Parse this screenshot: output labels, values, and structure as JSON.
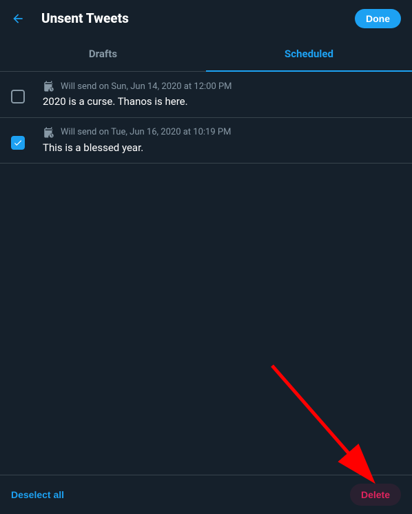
{
  "header": {
    "title": "Unsent Tweets",
    "done_label": "Done"
  },
  "tabs": {
    "drafts_label": "Drafts",
    "scheduled_label": "Scheduled",
    "active": "scheduled"
  },
  "tweets": [
    {
      "checked": false,
      "schedule_text": "Will send on Sun, Jun 14, 2020 at 12:00 PM",
      "content": "2020 is a curse. Thanos is here."
    },
    {
      "checked": true,
      "schedule_text": "Will send on Tue, Jun 16, 2020 at 10:19 PM",
      "content": "This is a blessed year."
    }
  ],
  "footer": {
    "deselect_label": "Deselect all",
    "delete_label": "Delete"
  }
}
